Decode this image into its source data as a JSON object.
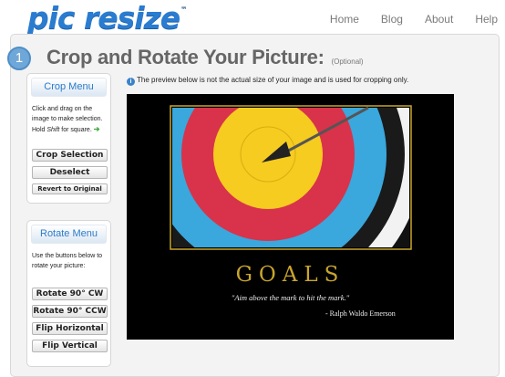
{
  "brand": {
    "logo_text": "pic resize",
    "tm": "™"
  },
  "nav": [
    {
      "label": "Home"
    },
    {
      "label": "Blog"
    },
    {
      "label": "About"
    },
    {
      "label": "Help"
    }
  ],
  "step": {
    "number": "1"
  },
  "page": {
    "title": "Crop and Rotate Your Picture:",
    "optional": "(Optional)"
  },
  "crop_menu": {
    "title": "Crop Menu",
    "desc_1": "Click and drag on the image to make selection. Hold ",
    "desc_shift": "Shift",
    "desc_2": " for square.",
    "arrow": "➔",
    "buttons": {
      "crop_selection": "Crop Selection",
      "deselect": "Deselect",
      "revert": "Revert to Original"
    }
  },
  "rotate_menu": {
    "title": "Rotate Menu",
    "desc": "Use the buttons below to rotate your picture:",
    "buttons": {
      "rotate_cw": "Rotate 90° CW",
      "rotate_ccw": "Rotate 90° CCW",
      "flip_h": "Flip Horizontal",
      "flip_v": "Flip Vertical"
    }
  },
  "info": {
    "icon": "i",
    "text": "The preview below is not the actual size of your image and is used for cropping only."
  },
  "poster": {
    "headline": "GOALS",
    "quote": "\"Aim above the mark to hit the mark.\"",
    "author": "- Ralph Waldo Emerson"
  },
  "colors": {
    "accent": "#2a7cd0",
    "poster_gold": "#c9a52c"
  }
}
